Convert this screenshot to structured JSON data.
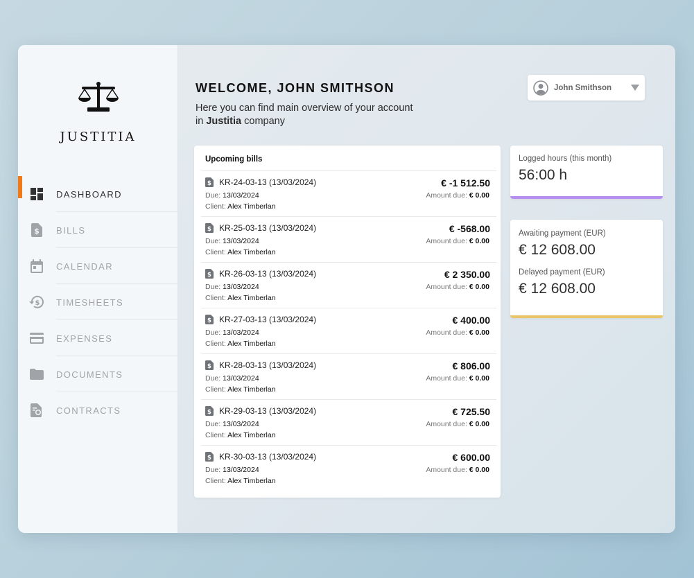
{
  "sidebar": {
    "logo_text": "JUSTITIA",
    "items": [
      {
        "label": "DASHBOARD",
        "icon": "dashboard-icon",
        "active": true
      },
      {
        "label": "BILLS",
        "icon": "dollar-document-icon",
        "active": false
      },
      {
        "label": "CALENDAR",
        "icon": "calendar-icon",
        "active": false
      },
      {
        "label": "TIMESHEETS",
        "icon": "history-dollar-icon",
        "active": false
      },
      {
        "label": "EXPENSES",
        "icon": "credit-card-icon",
        "active": false
      },
      {
        "label": "DOCUMENTS",
        "icon": "folder-icon",
        "active": false
      },
      {
        "label": "CONTRACTS",
        "icon": "certificate-document-icon",
        "active": false
      }
    ]
  },
  "header": {
    "welcome_prefix": "WELCOME,",
    "welcome_name": "JOHN SMITHSON",
    "intro_line1": "Here you can find main overview of your account",
    "intro_in": "in",
    "intro_company": "Justitia",
    "intro_suffix": "company"
  },
  "user_menu": {
    "name": "John Smithson"
  },
  "bills": {
    "title": "Upcoming bills",
    "due_label": "Due:",
    "client_label": "Client:",
    "amount_due_label": "Amount due:",
    "items": [
      {
        "number": "KR-24-03-13 (13/03/2024)",
        "due": "13/03/2024",
        "client": "Alex Timberlan",
        "amount": "€ -1 512.50",
        "amount_due": "€ 0.00"
      },
      {
        "number": "KR-25-03-13 (13/03/2024)",
        "due": "13/03/2024",
        "client": "Alex Timberlan",
        "amount": "€ -568.00",
        "amount_due": "€ 0.00"
      },
      {
        "number": "KR-26-03-13 (13/03/2024)",
        "due": "13/03/2024",
        "client": "Alex Timberlan",
        "amount": "€ 2 350.00",
        "amount_due": "€ 0.00"
      },
      {
        "number": "KR-27-03-13 (13/03/2024)",
        "due": "13/03/2024",
        "client": "Alex Timberlan",
        "amount": "€ 400.00",
        "amount_due": "€ 0.00"
      },
      {
        "number": "KR-28-03-13 (13/03/2024)",
        "due": "13/03/2024",
        "client": "Alex Timberlan",
        "amount": "€ 806.00",
        "amount_due": "€ 0.00"
      },
      {
        "number": "KR-29-03-13 (13/03/2024)",
        "due": "13/03/2024",
        "client": "Alex Timberlan",
        "amount": "€ 725.50",
        "amount_due": "€ 0.00"
      },
      {
        "number": "KR-30-03-13 (13/03/2024)",
        "due": "13/03/2024",
        "client": "Alex Timberlan",
        "amount": "€ 600.00",
        "amount_due": "€ 0.00"
      }
    ]
  },
  "stats": {
    "hours_label": "Logged hours (this month)",
    "hours_value": "56:00 h",
    "awaiting_label": "Awaiting payment (EUR)",
    "awaiting_value": "€ 12 608.00",
    "delayed_label": "Delayed payment (EUR)",
    "delayed_value": "€ 12 608.00"
  },
  "colors": {
    "accent": "#f07a1a",
    "hours_bar": "#b78ef0",
    "payments_bar": "#eac468"
  }
}
